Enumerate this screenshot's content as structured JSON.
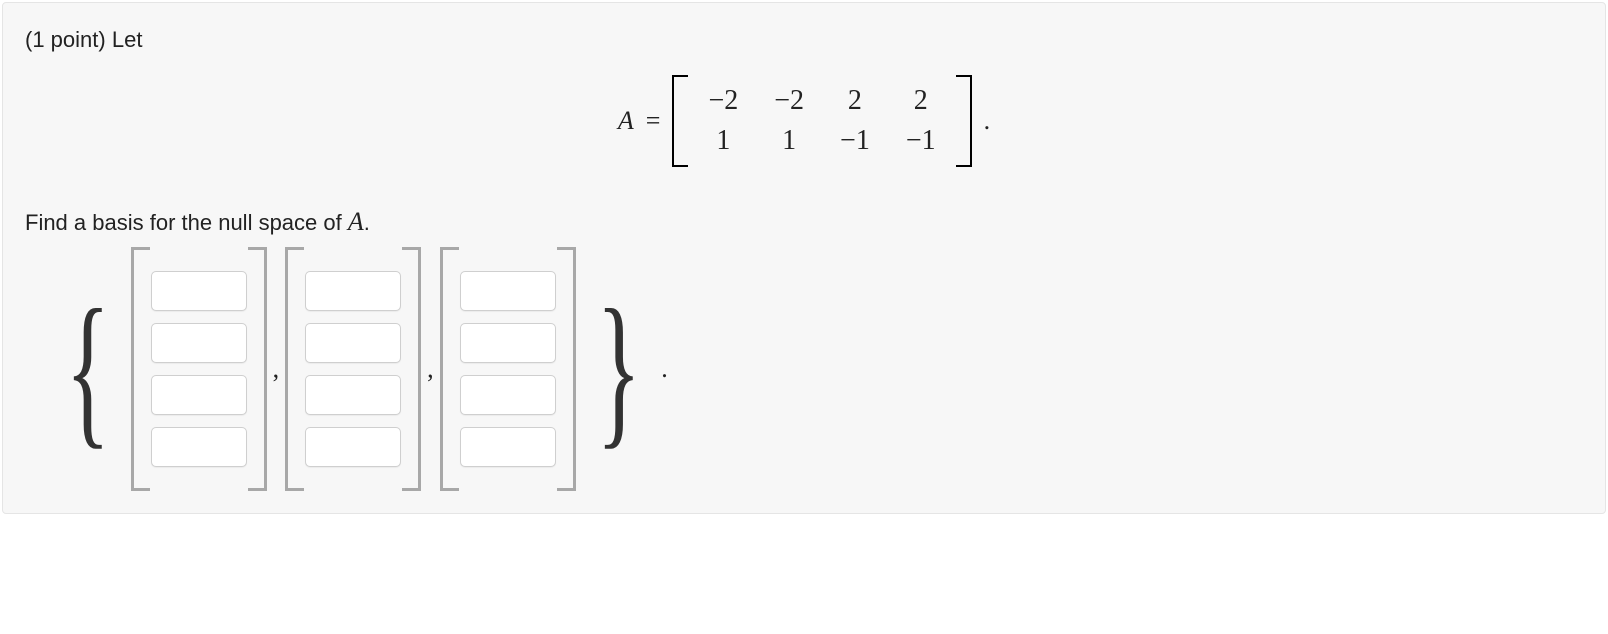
{
  "points_label": "(1 point)",
  "prompt_word": "Let",
  "matrix_row1": [
    "−2",
    "−2",
    "2",
    "2"
  ],
  "matrix_row2": [
    "1",
    "1",
    "−1",
    "−1"
  ],
  "eq_lhs": "A",
  "eq_sym": " = ",
  "trailing_period": " .",
  "question_line_prefix": "Find a basis for the null space of ",
  "question_line_var": "A",
  "question_line_suffix": ".",
  "final_period": "."
}
